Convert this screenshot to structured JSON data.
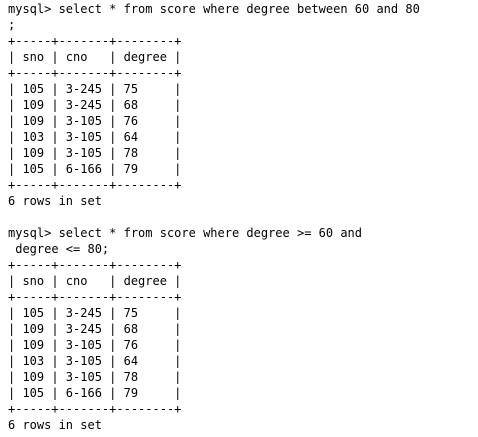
{
  "session": {
    "blocks": [
      {
        "command_lines": [
          "mysql> select * from score where degree between 60 and 80",
          ";"
        ],
        "table_lines": [
          "+-----+-------+--------+",
          "| sno | cno   | degree |",
          "+-----+-------+--------+",
          "| 105 | 3-245 | 75     |",
          "| 109 | 3-245 | 68     |",
          "| 109 | 3-105 | 76     |",
          "| 103 | 3-105 | 64     |",
          "| 109 | 3-105 | 78     |",
          "| 105 | 6-166 | 79     |",
          "+-----+-------+--------+"
        ],
        "result_summary": "6 rows in set"
      },
      {
        "command_lines": [
          "mysql> select * from score where degree >= 60 and",
          " degree <= 80;"
        ],
        "table_lines": [
          "+-----+-------+--------+",
          "| sno | cno   | degree |",
          "+-----+-------+--------+",
          "| 105 | 3-245 | 75     |",
          "| 109 | 3-245 | 68     |",
          "| 109 | 3-105 | 76     |",
          "| 103 | 3-105 | 64     |",
          "| 109 | 3-105 | 78     |",
          "| 105 | 6-166 | 79     |",
          "+-----+-------+--------+"
        ],
        "result_summary": "6 rows in set"
      }
    ]
  }
}
